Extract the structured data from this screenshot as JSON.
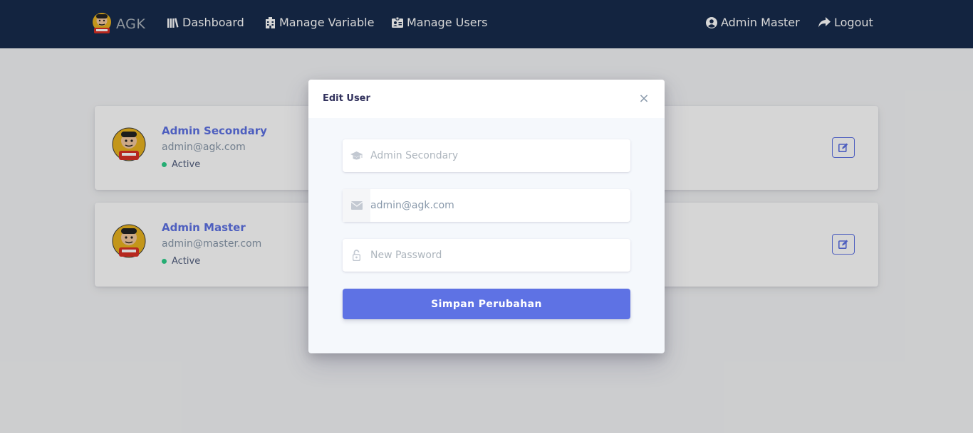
{
  "navbar": {
    "brand": "AGK",
    "links": [
      {
        "label": "Dashboard",
        "icon": "library-icon"
      },
      {
        "label": "Manage Variable",
        "icon": "building-icon"
      },
      {
        "label": "Manage Users",
        "icon": "id-badge-icon"
      }
    ],
    "user_label": "Admin Master",
    "logout_label": "Logout"
  },
  "users": [
    {
      "name": "Admin Secondary",
      "email": "admin@agk.com",
      "status": "Active"
    },
    {
      "name": "Admin Master",
      "email": "admin@master.com",
      "status": "Active"
    }
  ],
  "modal": {
    "title": "Edit User",
    "close_symbol": "×",
    "name_placeholder": "Admin Secondary",
    "email_value": "admin@agk.com",
    "password_placeholder": "New Password",
    "submit_label": "Simpan Perubahan"
  },
  "colors": {
    "navbar": "#172b4d",
    "primary": "#5e72e4",
    "status_active": "#2dce89"
  }
}
